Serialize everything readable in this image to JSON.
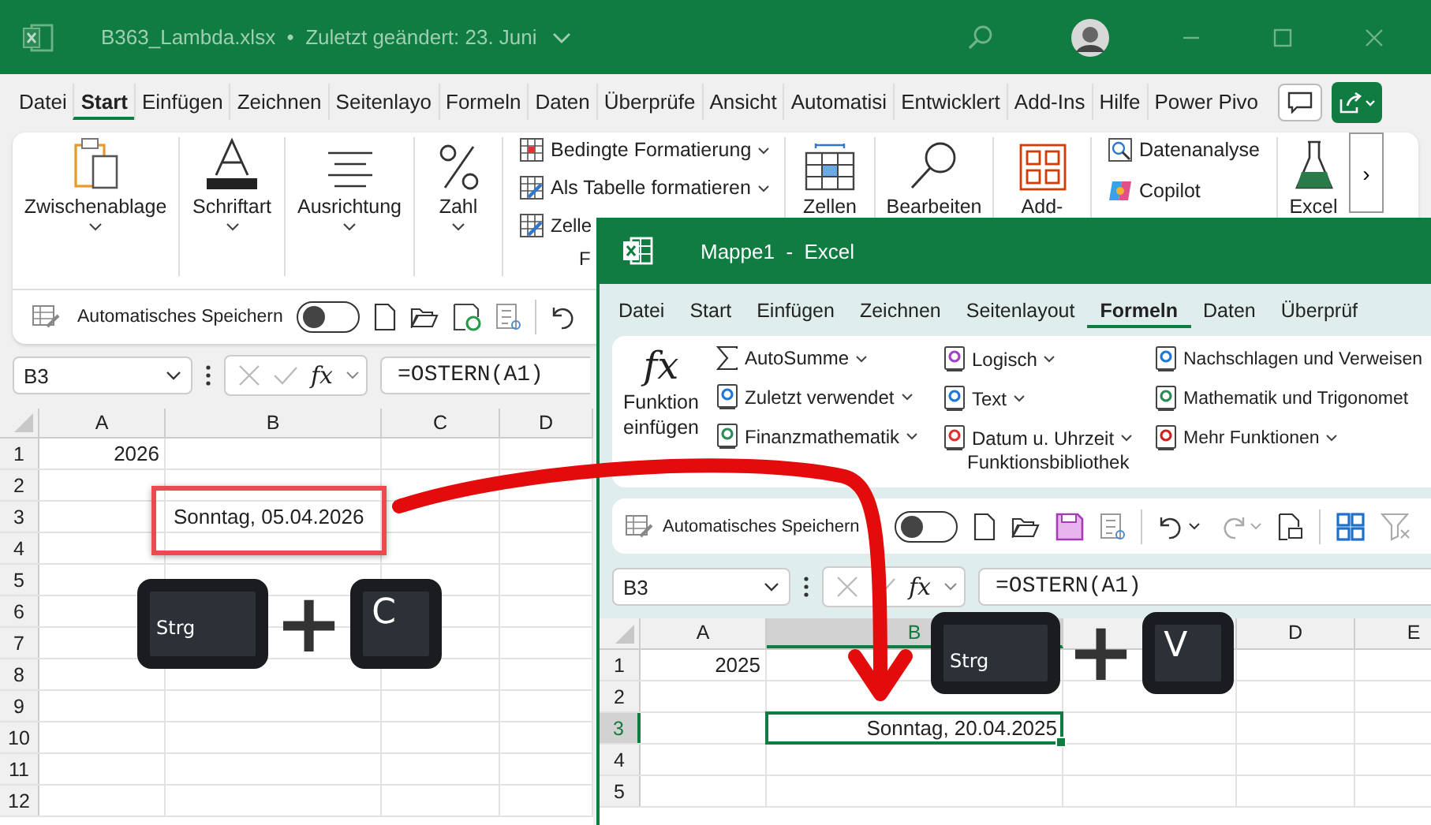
{
  "back_window": {
    "title": "B363_Lambda.xlsx  •  Zuletzt geändert: 23. Juni",
    "tabs": [
      {
        "label": "Datei",
        "selected": false
      },
      {
        "label": "Start",
        "selected": true
      },
      {
        "label": "Einfügen",
        "selected": false
      },
      {
        "label": "Zeichnen",
        "selected": false
      },
      {
        "label": "Seitenlayo",
        "selected": false
      },
      {
        "label": "Formeln",
        "selected": false
      },
      {
        "label": "Daten",
        "selected": false
      },
      {
        "label": "Überprüfe",
        "selected": false
      },
      {
        "label": "Ansicht",
        "selected": false
      },
      {
        "label": "Automatisi",
        "selected": false
      },
      {
        "label": "Entwicklert",
        "selected": false
      },
      {
        "label": "Add-Ins",
        "selected": false
      },
      {
        "label": "Hilfe",
        "selected": false
      },
      {
        "label": "Power Pivo",
        "selected": false
      }
    ],
    "ribbon": {
      "groups_left": [
        {
          "label": "Zwischenablage",
          "dropdown": true
        },
        {
          "label": "Schriftart",
          "dropdown": true
        },
        {
          "label": "Ausrichtung",
          "dropdown": true
        },
        {
          "label": "Zahl",
          "dropdown": true
        }
      ],
      "styles": [
        {
          "label": "Bedingte Formatierung",
          "dropdown": true
        },
        {
          "label": "Als Tabelle formatieren",
          "dropdown": true
        },
        {
          "label": "Zelle",
          "dropdown": false
        }
      ],
      "styles_group": "F",
      "groups_right": [
        {
          "label": "Zellen"
        },
        {
          "label": "Bearbeiten"
        },
        {
          "label": "Add-"
        }
      ],
      "analysis": [
        {
          "label": "Datenanalyse"
        },
        {
          "label": "Copilot"
        }
      ],
      "last_group": "Excel",
      "more": "›"
    },
    "quick_access": {
      "autosave_label": "Automatisches Speichern",
      "autosave_on": false
    },
    "formula_bar": {
      "name_box": "B3",
      "fx": "fx",
      "formula": "=OSTERN(A1)"
    },
    "grid": {
      "columns": [
        {
          "label": "A"
        },
        {
          "label": "B"
        },
        {
          "label": "C"
        },
        {
          "label": "D"
        }
      ],
      "rows": [
        {
          "header": "1",
          "column_a": "2026"
        },
        {
          "header": "2"
        },
        {
          "header": "3",
          "column_b": "Sonntag, 05.04.2026"
        },
        {
          "header": "4"
        },
        {
          "header": "5"
        },
        {
          "header": "6"
        },
        {
          "header": "7"
        },
        {
          "header": "8"
        },
        {
          "header": "9"
        },
        {
          "header": "10"
        },
        {
          "header": "11"
        },
        {
          "header": "12"
        }
      ]
    }
  },
  "front_window": {
    "title": "Mappe1  -  Excel",
    "tabs": [
      {
        "label": "Datei",
        "selected": false
      },
      {
        "label": "Start",
        "selected": false
      },
      {
        "label": "Einfügen",
        "selected": false
      },
      {
        "label": "Zeichnen",
        "selected": false
      },
      {
        "label": "Seitenlayout",
        "selected": false
      },
      {
        "label": "Formeln",
        "selected": true
      },
      {
        "label": "Daten",
        "selected": false
      },
      {
        "label": "Überprüf",
        "selected": false
      }
    ],
    "ribbon": {
      "insert_function": {
        "glyph": "fx",
        "label": "Funktion einfügen"
      },
      "columns": [
        [
          {
            "label": "AutoSumme",
            "dropdown": true
          },
          {
            "label": "Zuletzt verwendet",
            "dropdown": true
          },
          {
            "label": "Finanzmathematik",
            "dropdown": true
          }
        ],
        [
          {
            "label": "Logisch",
            "dropdown": true
          },
          {
            "label": "Text",
            "dropdown": true
          },
          {
            "label": "Datum u. Uhrzeit",
            "dropdown": true
          }
        ],
        [
          {
            "label": "Nachschlagen und Verweisen",
            "dropdown": false
          },
          {
            "label": "Mathematik und Trigonomet",
            "dropdown": false
          },
          {
            "label": "Mehr Funktionen",
            "dropdown": true
          }
        ]
      ],
      "group_label": "Funktionsbibliothek"
    },
    "quick_access": {
      "autosave_label": "Automatisches Speichern",
      "autosave_on": false
    },
    "formula_bar": {
      "name_box": "B3",
      "fx": "fx",
      "formula": "=OSTERN(A1)"
    },
    "grid": {
      "columns": [
        {
          "label": "A",
          "selected": false
        },
        {
          "label": "B",
          "selected": true
        },
        {
          "selected": false
        },
        {
          "label": "D",
          "selected": false
        },
        {
          "label": "E",
          "selected": false
        }
      ],
      "rows": [
        {
          "header": "1",
          "selected": false,
          "column_a": "2025"
        },
        {
          "header": "2",
          "selected": false
        },
        {
          "header": "3",
          "selected": true,
          "column_b": "Sonntag, 20.04.2025"
        },
        {
          "header": "4",
          "selected": false
        },
        {
          "header": "5",
          "selected": false
        }
      ]
    }
  },
  "shortcuts": [
    {
      "keys": [
        "Strg",
        "C"
      ],
      "plus": "+"
    },
    {
      "keys": [
        "Strg",
        "V"
      ],
      "plus": "+"
    }
  ]
}
